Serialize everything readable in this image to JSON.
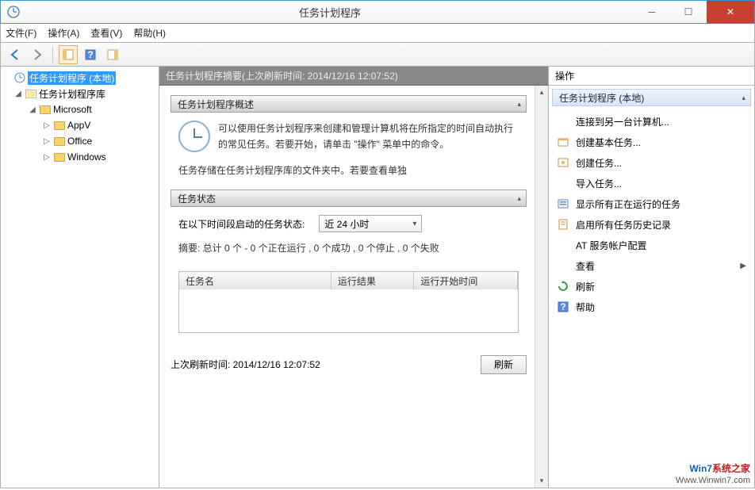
{
  "window": {
    "title": "任务计划程序"
  },
  "menus": {
    "file": "文件(F)",
    "action": "操作(A)",
    "view": "查看(V)",
    "help": "帮助(H)"
  },
  "tree": {
    "root": "任务计划程序 (本地)",
    "lib": "任务计划程序库",
    "ms": "Microsoft",
    "appv": "AppV",
    "office": "Office",
    "windows": "Windows"
  },
  "center": {
    "header": "任务计划程序摘要(上次刷新时间: 2014/12/16 12:07:52)",
    "overview_title": "任务计划程序概述",
    "overview_text1": "可以使用任务计划程序来创建和管理计算机将在所指定的时间自动执行的常见任务。若要开始，请单击 \"操作\" 菜单中的命令。",
    "overview_text2": "任务存储在任务计划程序库的文件夹中。若要查看单独",
    "status_title": "任务状态",
    "status_label": "在以下时间段启动的任务状态:",
    "status_combo": "近 24 小时",
    "summary_line": "摘要: 总计 0 个 - 0 个正在运行 , 0 个成功 , 0 个停止 , 0 个失败",
    "col_name": "任务名",
    "col_result": "运行结果",
    "col_start": "运行开始时间",
    "last_refresh": "上次刷新时间: 2014/12/16 12:07:52",
    "refresh_btn": "刷新"
  },
  "actions": {
    "pane_title": "操作",
    "group": "任务计划程序 (本地)",
    "items": {
      "connect": "连接到另一台计算机...",
      "create_basic": "创建基本任务...",
      "create": "创建任务...",
      "import": "导入任务...",
      "show_running": "显示所有正在运行的任务",
      "enable_history": "启用所有任务历史记录",
      "at_account": "AT 服务帐户配置",
      "view": "查看",
      "refresh": "刷新",
      "help": "帮助"
    }
  },
  "watermark": {
    "line1a": "Win7",
    "line1b": "系统之家",
    "line2": "Www.Winwin7.com"
  }
}
